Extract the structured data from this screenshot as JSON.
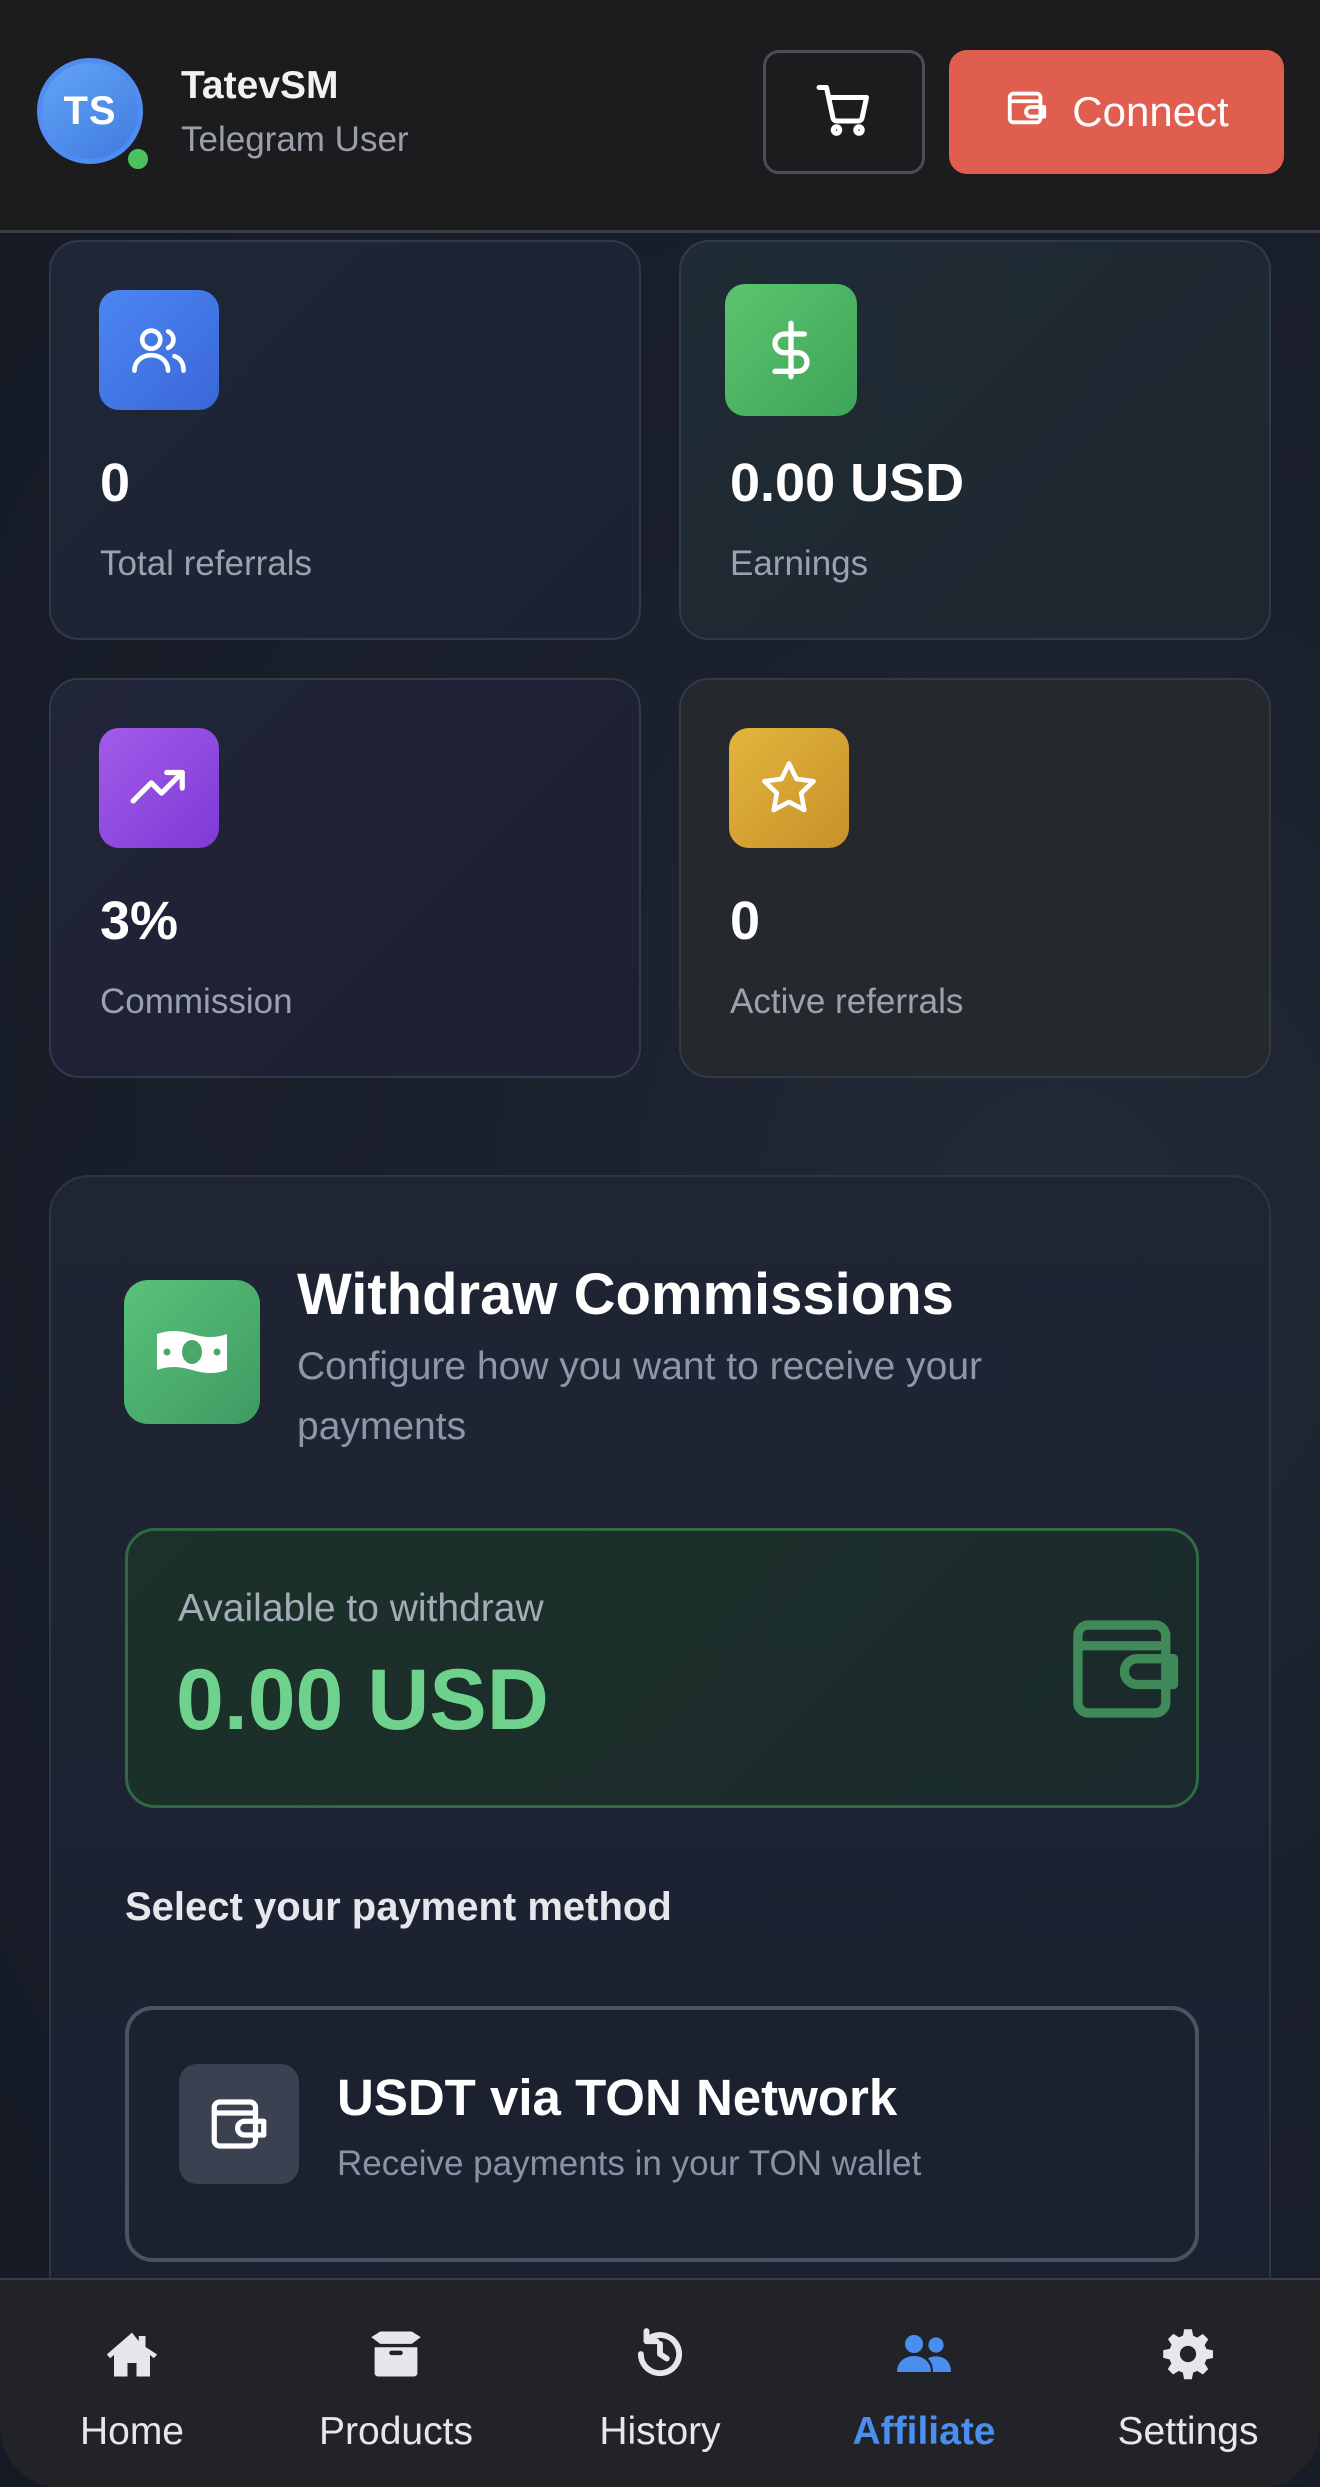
{
  "header": {
    "avatar_initials": "TS",
    "user_name": "TatevSM",
    "user_subtitle": "Telegram User",
    "connect_label": "Connect"
  },
  "stats": [
    {
      "value": "0",
      "label": "Total referrals",
      "icon": "users-icon"
    },
    {
      "value": "0.00 USD",
      "label": "Earnings",
      "icon": "dollar-icon"
    },
    {
      "value": "3%",
      "label": "Commission",
      "icon": "trending-up-icon"
    },
    {
      "value": "0",
      "label": "Active referrals",
      "icon": "star-icon"
    }
  ],
  "withdraw": {
    "title": "Withdraw Commissions",
    "subtitle": "Configure how you want to receive your payments",
    "available_label": "Available to withdraw",
    "available_amount": "0.00 USD",
    "payment_heading": "Select your payment method",
    "payment_option": {
      "title": "USDT via TON Network",
      "subtitle": "Receive payments in your TON wallet"
    }
  },
  "nav": [
    {
      "label": "Home",
      "icon": "home-icon"
    },
    {
      "label": "Products",
      "icon": "box-icon"
    },
    {
      "label": "History",
      "icon": "history-icon"
    },
    {
      "label": "Affiliate",
      "icon": "users-icon",
      "active": true
    },
    {
      "label": "Settings",
      "icon": "gear-icon"
    }
  ],
  "colors": {
    "accent_blue": "#4a8ff0",
    "connect_red": "#e05e4f",
    "success_green": "#6fd28c"
  }
}
